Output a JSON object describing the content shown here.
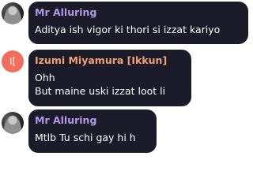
{
  "colors": {
    "bubble_bg": "#1c1b29",
    "name_mr_alluring": "#b19ae8",
    "name_izumi": "#f4a072",
    "text": "#ffffff",
    "izumi_avatar_bg": "#f26d5b"
  },
  "messages": [
    {
      "author": "Mr Alluring",
      "avatar": "profile-photo",
      "lines": [
        "Aditya ish vigor ki thori si izzat kariyo"
      ]
    },
    {
      "author": "Izumi Miyamura [Ikkun]",
      "avatar_initials": "I[",
      "lines": [
        "Ohh",
        "But maine uski izzat loot li"
      ]
    },
    {
      "author": "Mr Alluring",
      "avatar": "profile-photo",
      "lines": [
        "Mtlb Tu schi gay hi h"
      ]
    }
  ]
}
